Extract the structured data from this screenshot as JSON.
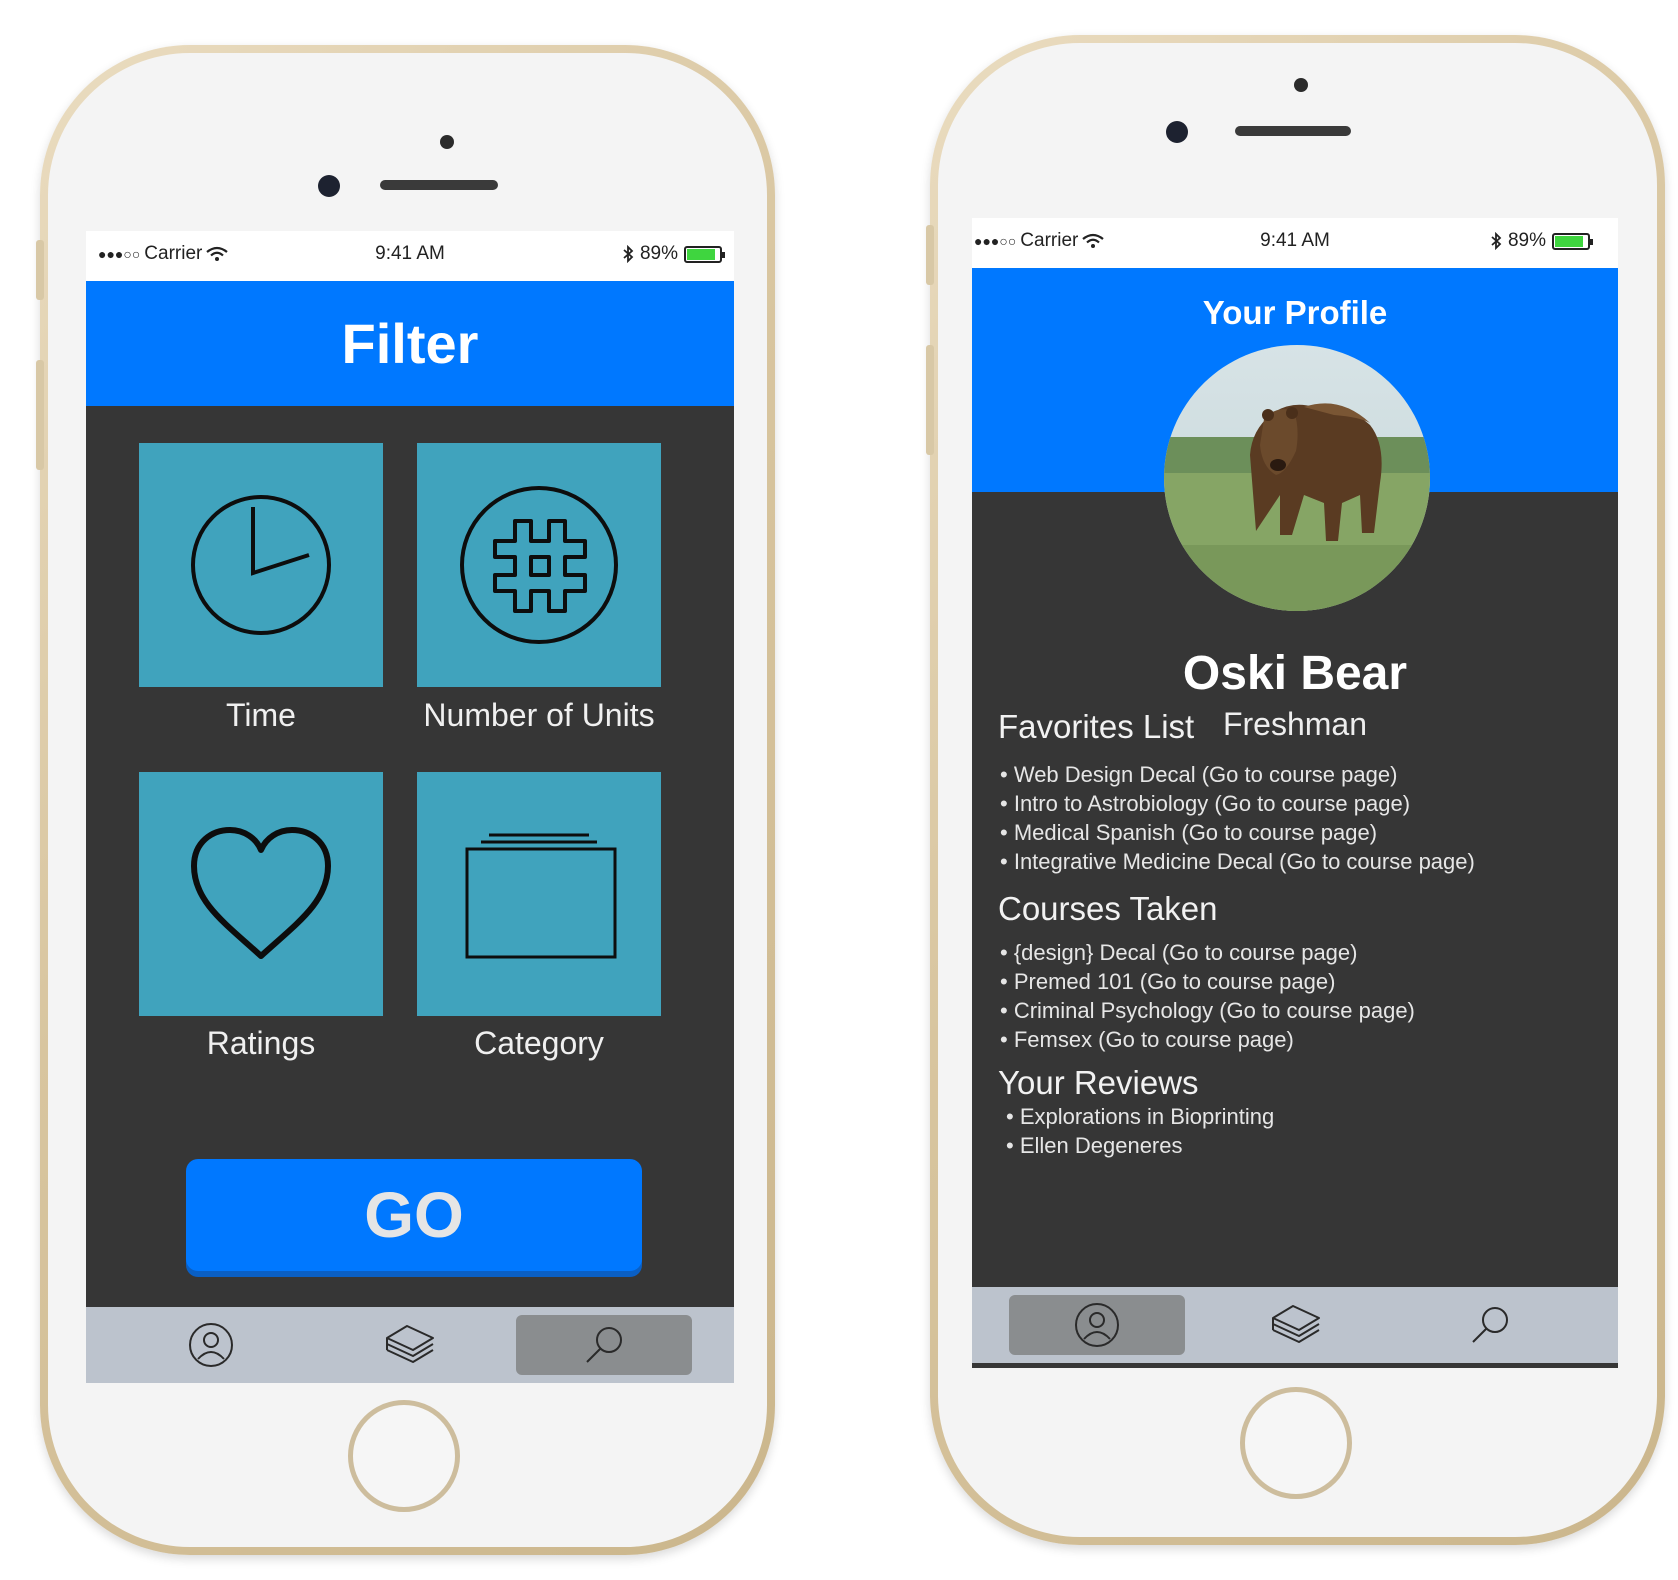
{
  "status_bar": {
    "signal": "●●●○○",
    "carrier": "Carrier",
    "time": "9:41 AM",
    "bluetooth_icon": "bluetooth-icon",
    "battery": "89%",
    "battery_level": 0.89,
    "battery_color": "#3fd53f"
  },
  "filter_screen": {
    "title": "Filter",
    "options": [
      {
        "label": "Time",
        "icon": "clock-icon"
      },
      {
        "label": "Number of Units",
        "icon": "hashtag-icon"
      },
      {
        "label": "Ratings",
        "icon": "heart-icon"
      },
      {
        "label": "Category",
        "icon": "folder-stack-icon"
      }
    ],
    "go_label": "GO",
    "tabs": [
      {
        "icon": "profile-icon",
        "active": false
      },
      {
        "icon": "books-icon",
        "active": false
      },
      {
        "icon": "search-icon",
        "active": true
      }
    ]
  },
  "profile_screen": {
    "title": "Your Profile",
    "name": "Oski Bear",
    "class_year": "Freshman",
    "favorites_title": "Favorites List",
    "favorites": [
      "Web Design Decal (Go to course page)",
      "Intro to Astrobiology (Go to course page)",
      "Medical Spanish (Go to course page)",
      "Integrative Medicine Decal (Go to course page)"
    ],
    "courses_title": "Courses Taken",
    "courses": [
      "{design} Decal (Go to course page)",
      "Premed 101 (Go to course page)",
      "Criminal Psychology (Go to course page)",
      "Femsex (Go to course page)"
    ],
    "reviews_title": "Your Reviews",
    "reviews": [
      "Explorations in Bioprinting",
      "Ellen Degeneres"
    ],
    "tabs": [
      {
        "icon": "profile-icon",
        "active": true
      },
      {
        "icon": "books-icon",
        "active": false
      },
      {
        "icon": "search-icon",
        "active": false
      }
    ]
  },
  "colors": {
    "accent_blue": "#0078ff",
    "tile_teal": "#40a3bd",
    "screen_dark": "#363636",
    "tabbar_gray": "#bcc3cd"
  }
}
